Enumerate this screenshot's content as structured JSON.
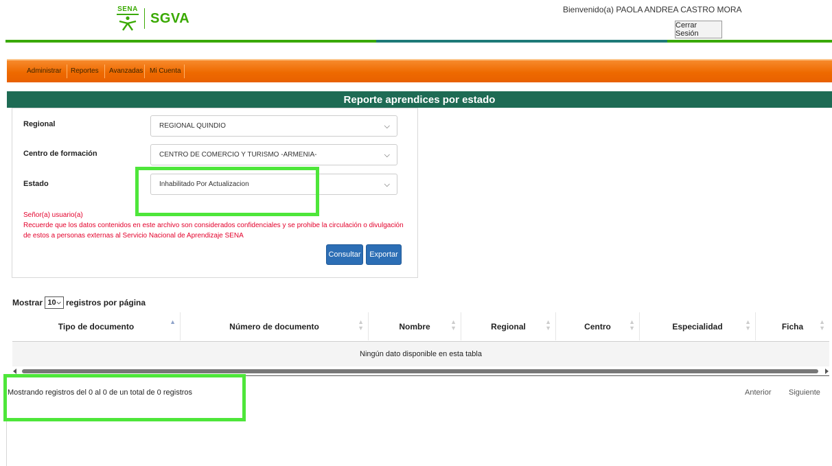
{
  "header": {
    "logo_text": "SENA",
    "app_name": "SGVA",
    "welcome": "Bienvenido(a) PAOLA ANDREA CASTRO MORA",
    "logout_label": "Cerrar Sesión",
    "colors": {
      "brand_green": "#39a900",
      "teal": "#1e7a78"
    }
  },
  "nav": {
    "items": [
      {
        "label": "Administrar"
      },
      {
        "label": "Reportes"
      },
      {
        "label": "Avanzadas"
      },
      {
        "label": "Mi Cuenta"
      }
    ],
    "color": "#ee6a00"
  },
  "page_title": "Reporte aprendices por estado",
  "form": {
    "regional_label": "Regional",
    "regional_value": "REGIONAL QUINDIO",
    "centro_label": "Centro de formación",
    "centro_value": "CENTRO DE COMERCIO Y TURISMO -ARMENIA-",
    "estado_label": "Estado",
    "estado_value": "Inhabilitado Por Actualizacion",
    "warning_title": "Señor(a) usuario(a)",
    "warning_line1": "Recuerde que los datos contenidos en este archivo son considerados confidenciales y se prohibe la circulación o divulgación",
    "warning_line2": "de estos a personas externas al Servicio Nacional de Aprendizaje SENA",
    "consultar_label": "Consultar",
    "exportar_label": "Exportar"
  },
  "table": {
    "length_prefix": "Mostrar",
    "length_value": "10",
    "length_suffix": "registros por página",
    "columns": [
      {
        "label": "Tipo de documento"
      },
      {
        "label": "Número de documento"
      },
      {
        "label": "Nombre"
      },
      {
        "label": "Regional"
      },
      {
        "label": "Centro"
      },
      {
        "label": "Especialidad"
      },
      {
        "label": "Ficha"
      }
    ],
    "empty_message": "Ningún dato disponible en esta tabla",
    "info": "Mostrando registros del 0 al 0 de un total de 0 registros",
    "prev_label": "Anterior",
    "next_label": "Siguiente"
  },
  "highlight_color": "#4ee63a"
}
